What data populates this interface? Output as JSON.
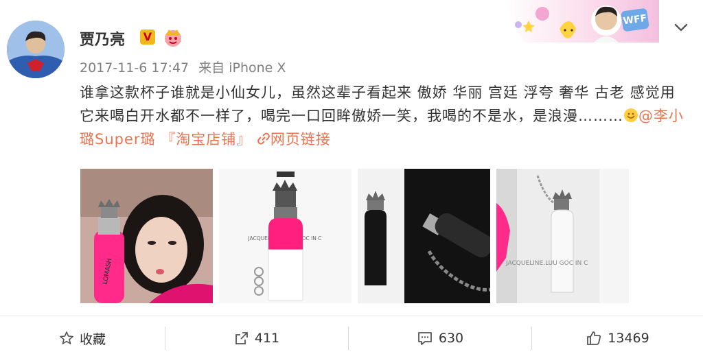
{
  "post": {
    "author": "贾乃亮",
    "time": "2017-11-6 17:47",
    "source": "来自 iPhone X",
    "text_part1": "谁拿这款杯子谁就是小仙女儿，虽然这辈子看起来  傲娇  华丽  宫廷  浮夸  奢华  古老   感觉用它来喝白开水都不一样了，喝完一口回眸傲娇一笑，我喝的不是水，是浪漫………",
    "mention": "@李小璐Super璐",
    "shop": "『淘宝店铺』",
    "web_link": "网页链接",
    "badges": {
      "v": "V",
      "fan": "WFF"
    },
    "images": [
      {
        "text": "LOMASH"
      },
      {
        "text": "JACQUELINE LUU X GOC IN C"
      },
      {
        "text": ""
      },
      {
        "text": "JACQUELINE.LUU GOC IN C"
      }
    ]
  },
  "actions": {
    "favorite": "收藏",
    "repost": "411",
    "comment": "630",
    "like": "13469"
  },
  "colors": {
    "link": "#eb7350",
    "meta": "#808080",
    "text": "#333333"
  }
}
